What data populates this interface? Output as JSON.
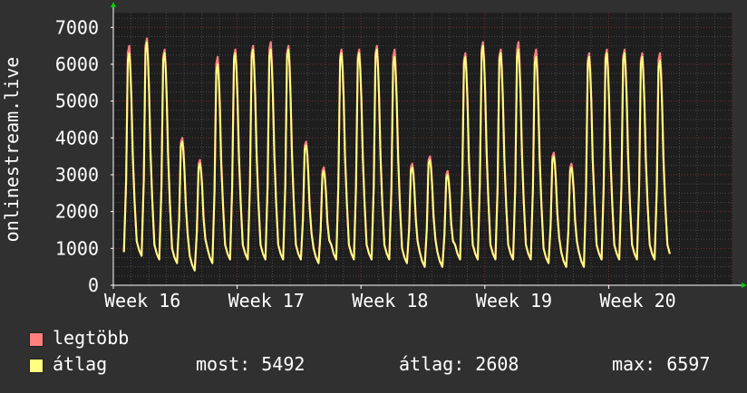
{
  "chart_data": {
    "type": "line",
    "ylabel": "onlinestream.live",
    "y_ticks": [
      0,
      1000,
      2000,
      3000,
      4000,
      5000,
      6000,
      7000
    ],
    "ylim": [
      0,
      7400
    ],
    "x_ticks": [
      "Week 16",
      "Week 17",
      "Week 18",
      "Week 19",
      "Week 20"
    ],
    "xlim_days": [
      0,
      35
    ],
    "grid": true,
    "series": [
      {
        "name": "legtöbb",
        "color": "#ff7f7f"
      },
      {
        "name": "átlag",
        "color": "#ffff80"
      }
    ],
    "daily_peaks_max": [
      6500,
      6700,
      6400,
      4000,
      3400,
      6200,
      6400,
      6500,
      6600,
      6500,
      3900,
      3200,
      6400,
      6400,
      6500,
      6400,
      3300,
      3500,
      3100,
      6300,
      6600,
      6400,
      6600,
      6400,
      3600,
      3300,
      6300,
      6400,
      6400,
      6300,
      6300
    ],
    "daily_peaks_avg": [
      6300,
      6600,
      6300,
      3900,
      3300,
      6000,
      6300,
      6400,
      6400,
      6400,
      3800,
      3100,
      6300,
      6300,
      6400,
      6200,
      3200,
      3400,
      3000,
      6200,
      6500,
      6300,
      6400,
      6200,
      3500,
      3200,
      6200,
      6300,
      6300,
      6200,
      6100
    ],
    "daily_lows": [
      900,
      800,
      700,
      600,
      400,
      600,
      700,
      700,
      700,
      700,
      700,
      600,
      700,
      700,
      700,
      700,
      600,
      500,
      500,
      700,
      700,
      700,
      700,
      700,
      600,
      500,
      500,
      700,
      700,
      700,
      700
    ]
  },
  "legend": {
    "max_label": "legtöbb",
    "avg_label": "átlag",
    "max_color": "#ff7f7f",
    "avg_color": "#ffff80"
  },
  "stats": {
    "now": "most: 5492",
    "avg": "átlag: 2608",
    "max": "max: 6597"
  },
  "colors": {
    "background": "#303030",
    "plot_background": "#1e1e1e",
    "grid_major": "#7a3030",
    "grid_minor": "#4a4a4a",
    "axis": "#ffffff",
    "arrow": "#00cc00"
  }
}
